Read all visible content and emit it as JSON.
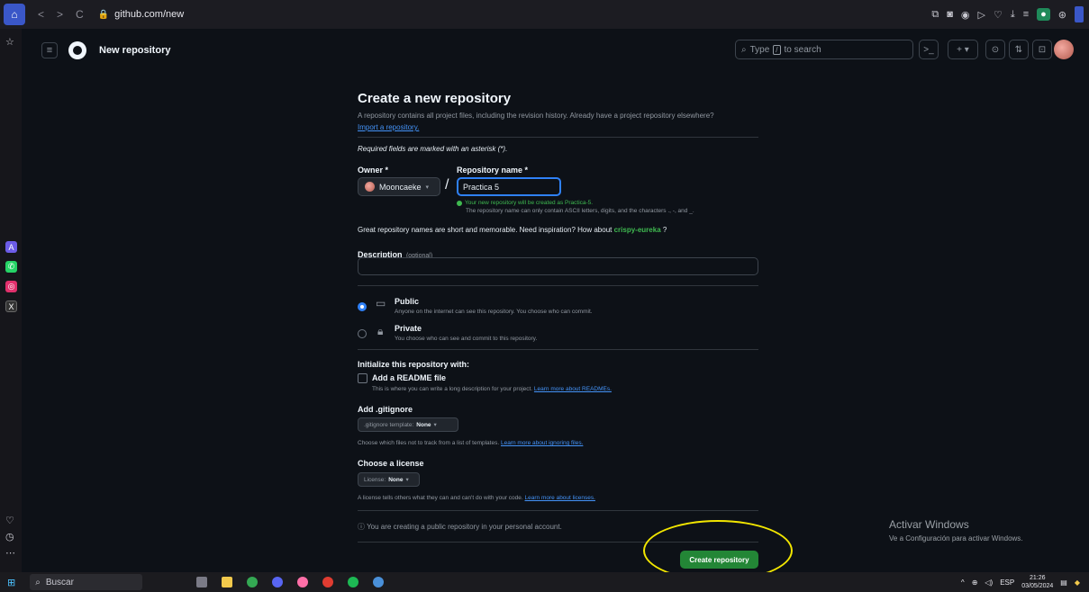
{
  "browser": {
    "url": "github.com/new",
    "home_icon": "home-icon",
    "back_icon": "<",
    "forward_icon": ">",
    "reload_icon": "C",
    "lock_icon": "lock-icon",
    "extension_icons": [
      "⧉",
      "◙",
      "◉",
      "▷",
      "♡",
      "⤓",
      "≡",
      "●",
      "⊛"
    ]
  },
  "sidebar": {
    "colors": [
      "#6c5ce7",
      "#25d366",
      "#e1306c",
      "#333333"
    ],
    "glyphs": [
      "X"
    ]
  },
  "github_header": {
    "title": "New repository",
    "search_prefix": "Type",
    "search_key": "/",
    "search_suffix": "to search",
    "terminal_label": ">_",
    "plus_label": "+ ▾",
    "issues_label": "⊙",
    "pr_label": "⇅",
    "inbox_label": "⊡"
  },
  "form": {
    "title": "Create a new repository",
    "subtitle": "A repository contains all project files, including the revision history. Already have a project repository elsewhere?",
    "import_link": "Import a repository.",
    "required_note": "Required fields are marked with an asterisk (*).",
    "owner_label": "Owner *",
    "owner_value": "Mooncaeke",
    "repo_name_label": "Repository name *",
    "repo_name_value": "Practica 5",
    "slash": "/",
    "ok_message": "Your new repository will be created as Practica-5.",
    "rules_message": "The repository name can only contain ASCII letters, digits, and the characters ., -, and _.",
    "inspiration_prefix": "Great repository names are short and memorable. Need inspiration? How about",
    "inspiration_suggestion": "crispy-eureka",
    "inspiration_suffix": "?",
    "description_label": "Description",
    "description_optional": "(optional)",
    "public_label": "Public",
    "public_desc": "Anyone on the internet can see this repository. You choose who can commit.",
    "private_label": "Private",
    "private_desc": "You choose who can see and commit to this repository.",
    "init_title": "Initialize this repository with:",
    "readme_label": "Add a README file",
    "readme_desc": "This is where you can write a long description for your project.",
    "readme_link": "Learn more about READMEs.",
    "gitignore_title": "Add .gitignore",
    "gitignore_prefix": ".gitignore template:",
    "gitignore_value": "None",
    "gitignore_desc": "Choose which files not to track from a list of templates.",
    "gitignore_link": "Learn more about ignoring files.",
    "license_title": "Choose a license",
    "license_prefix": "License:",
    "license_value": "None",
    "license_desc": "A license tells others what they can and can't do with your code.",
    "license_link": "Learn more about licenses.",
    "public_notice": "You are creating a public repository in your personal account.",
    "create_button": "Create repository"
  },
  "watermark": {
    "line1": "Activar Windows",
    "line2": "Ve a Configuración para activar Windows."
  },
  "taskbar": {
    "search_placeholder": "Buscar",
    "language": "ESP",
    "time": "21:26",
    "date": "03/05/2024",
    "app_colors": [
      "#4a90d9",
      "#f2c94c",
      "#34a853",
      "#5865f2",
      "#ff6fa8",
      "#e03c31",
      "#1db954",
      "#7a7a86"
    ]
  }
}
